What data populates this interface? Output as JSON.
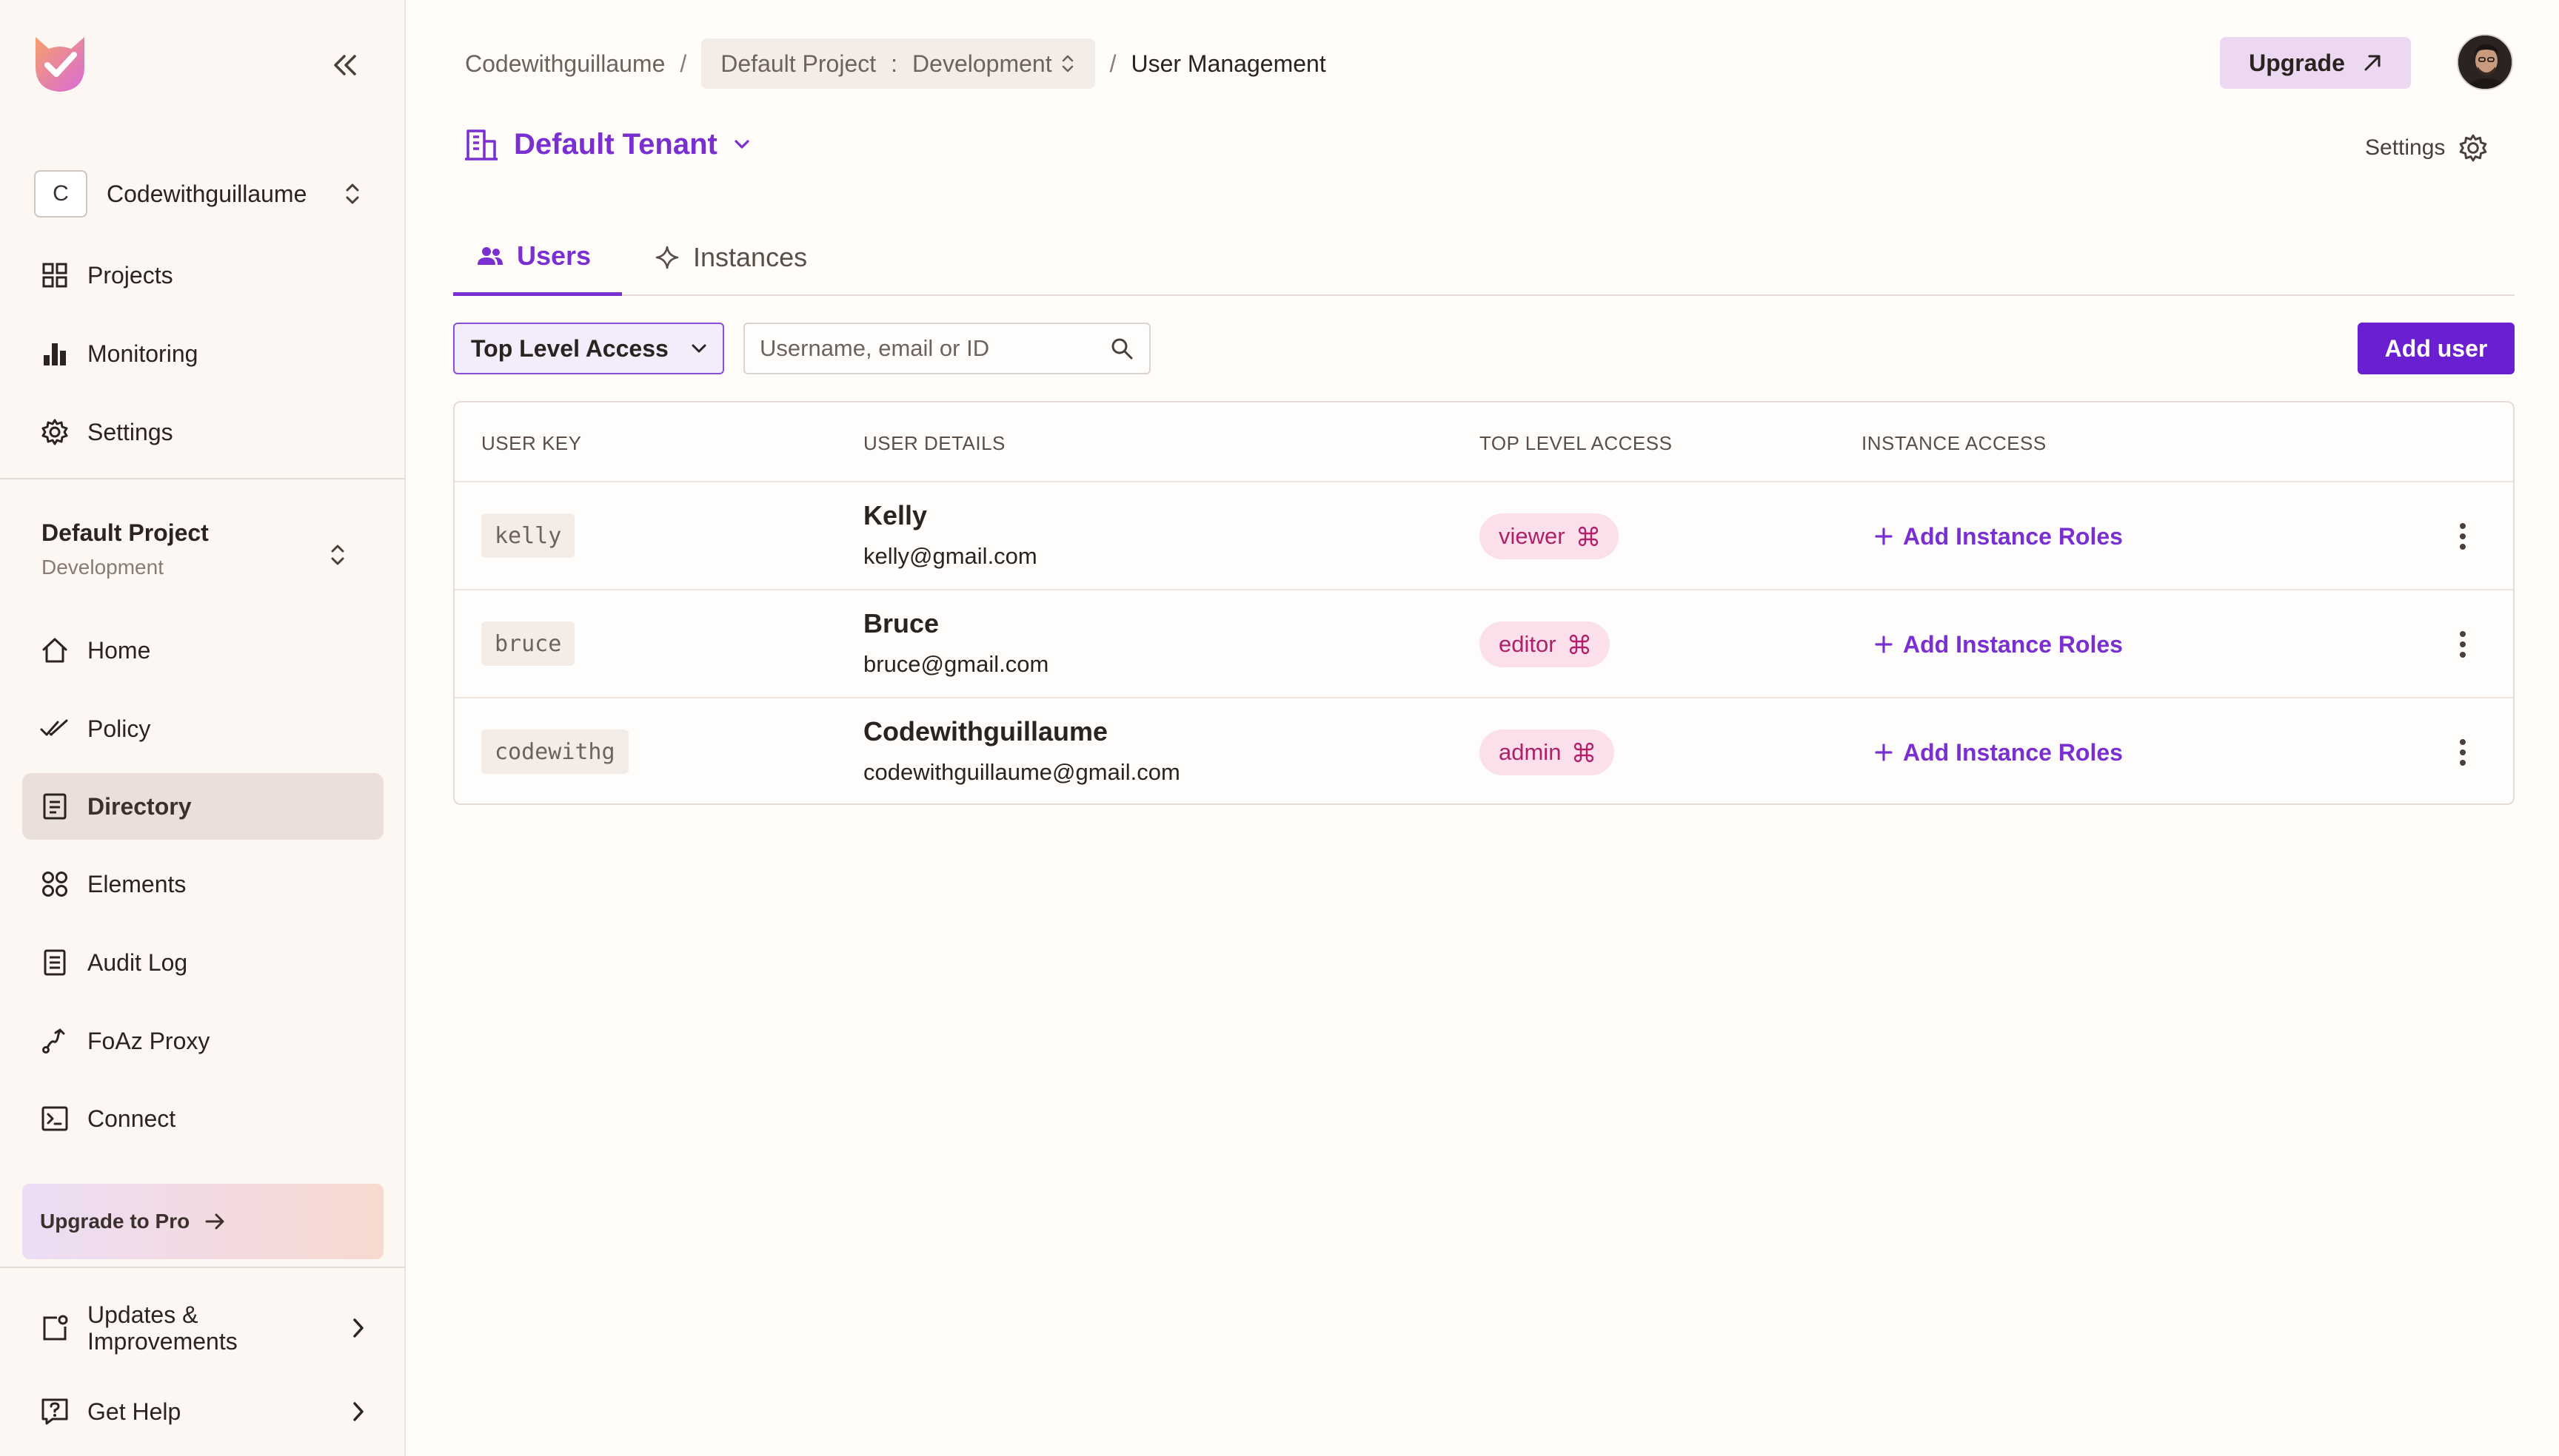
{
  "sidebar": {
    "org": {
      "initial": "C",
      "name": "Codewithguillaume"
    },
    "org_nav": [
      {
        "label": "Projects",
        "icon": "grid-icon"
      },
      {
        "label": "Monitoring",
        "icon": "bar-chart-icon"
      },
      {
        "label": "Settings",
        "icon": "gear-icon"
      }
    ],
    "project": {
      "name": "Default Project",
      "env": "Development"
    },
    "project_nav": [
      {
        "label": "Home",
        "icon": "home-icon"
      },
      {
        "label": "Policy",
        "icon": "double-check-icon"
      },
      {
        "label": "Directory",
        "icon": "directory-icon",
        "active": true
      },
      {
        "label": "Elements",
        "icon": "elements-icon"
      },
      {
        "label": "Audit Log",
        "icon": "document-icon"
      },
      {
        "label": "FoAz Proxy",
        "icon": "route-icon"
      },
      {
        "label": "Connect",
        "icon": "terminal-icon"
      }
    ],
    "upgrade_label": "Upgrade to Pro",
    "bottom": [
      {
        "label_line1": "Updates &",
        "label_line2": "Improvements",
        "icon": "updates-icon"
      },
      {
        "label": "Get Help",
        "icon": "help-icon"
      }
    ]
  },
  "header": {
    "breadcrumb": {
      "org": "Codewithguillaume",
      "project": "Default Project",
      "env_sep": ":",
      "env": "Development",
      "current": "User Management",
      "sep": "/"
    },
    "upgrade_label": "Upgrade"
  },
  "tenant": {
    "label": "Default Tenant"
  },
  "settings_label": "Settings",
  "tabs": [
    {
      "label": "Users",
      "active": true
    },
    {
      "label": "Instances",
      "active": false
    }
  ],
  "toolbar": {
    "filter_label": "Top Level Access",
    "search_placeholder": "Username, email or ID",
    "search_value": "",
    "add_user_label": "Add user"
  },
  "table": {
    "columns": [
      "USER KEY",
      "USER DETAILS",
      "TOP LEVEL ACCESS",
      "INSTANCE ACCESS"
    ],
    "rows": [
      {
        "key": "kelly",
        "name": "Kelly",
        "email": "kelly@gmail.com",
        "role": "viewer",
        "action": "Add Instance Roles"
      },
      {
        "key": "bruce",
        "name": "Bruce",
        "email": "bruce@gmail.com",
        "role": "editor",
        "action": "Add Instance Roles"
      },
      {
        "key": "codewithg",
        "name": "Codewithguillaume",
        "email": "codewithguillaume@gmail.com",
        "role": "admin",
        "action": "Add Instance Roles"
      }
    ]
  },
  "colors": {
    "accent": "#7a2fd0",
    "primary_button": "#6a1fd0",
    "role_pill_bg": "#fbe0ec",
    "role_pill_text": "#b0206a",
    "sidebar_bg": "#fdf7f3",
    "active_nav_bg": "#ebdfda"
  }
}
